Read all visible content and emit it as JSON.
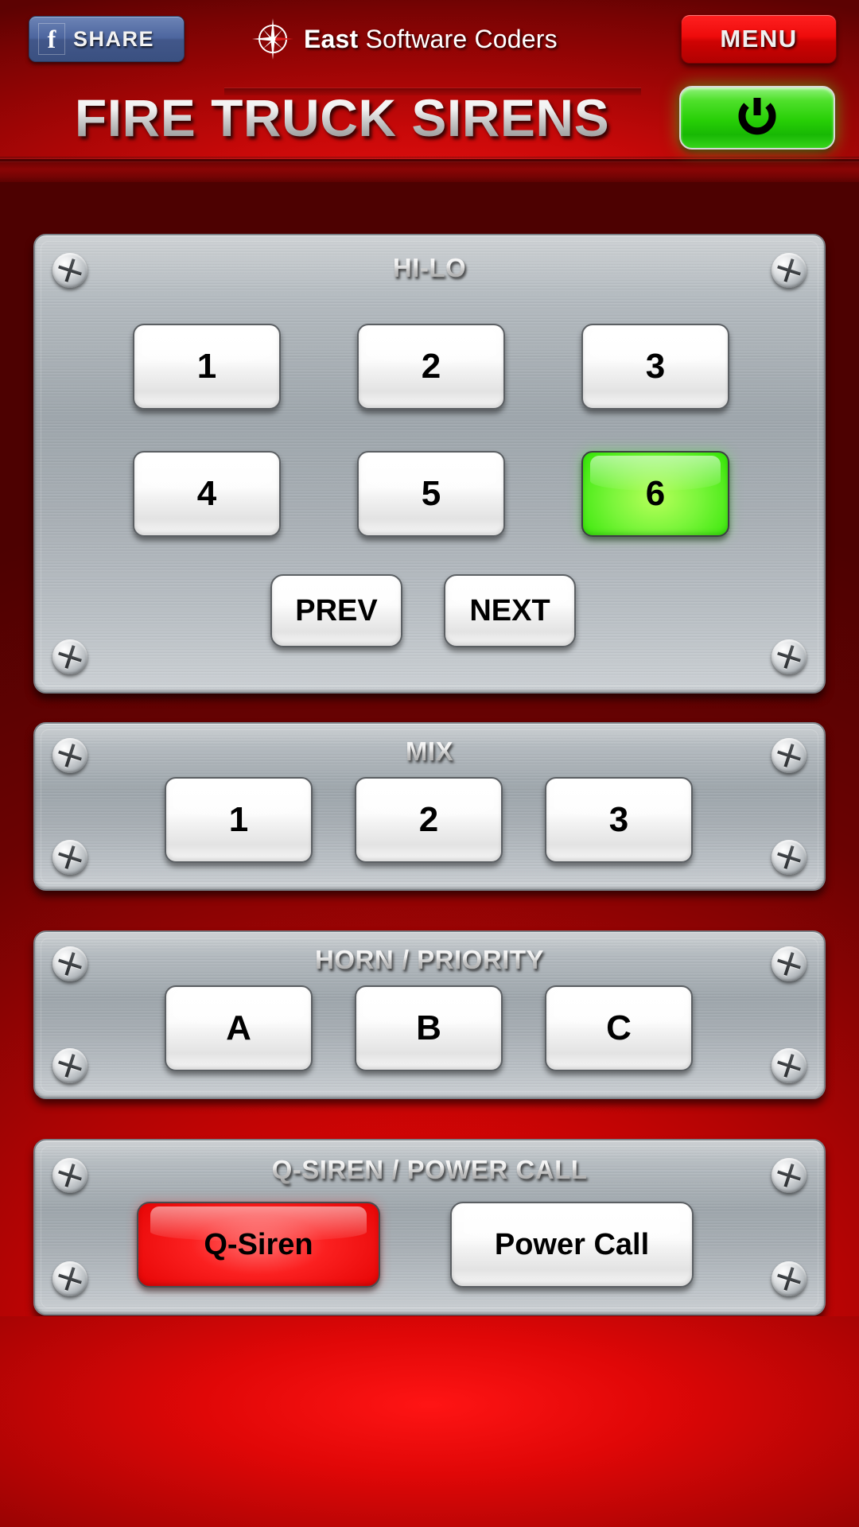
{
  "header": {
    "share_button": {
      "label": "SHARE",
      "icon": "facebook-icon",
      "glyph": "f",
      "color": "#4c659e"
    },
    "brand": {
      "name_bold": "East",
      "name_rest": " Software Coders",
      "icon": "compass-rose-icon"
    },
    "menu_button": {
      "label": "MENU",
      "color": "#ee0b0b"
    },
    "app_title": "FIRE TRUCK SIRENS",
    "power_button": {
      "icon": "power-icon",
      "state": "on",
      "color": "#27cf06"
    }
  },
  "panels": [
    {
      "id": "hi-lo",
      "title": "HI-LO",
      "buttons": [
        {
          "label": "1",
          "state": "off"
        },
        {
          "label": "2",
          "state": "off"
        },
        {
          "label": "3",
          "state": "off"
        },
        {
          "label": "4",
          "state": "off"
        },
        {
          "label": "5",
          "state": "off"
        },
        {
          "label": "6",
          "state": "active"
        }
      ],
      "nav": [
        {
          "label": "PREV"
        },
        {
          "label": "NEXT"
        }
      ]
    },
    {
      "id": "mix",
      "title": "MIX",
      "buttons": [
        {
          "label": "1",
          "state": "off"
        },
        {
          "label": "2",
          "state": "off"
        },
        {
          "label": "3",
          "state": "off"
        }
      ]
    },
    {
      "id": "horn-priority",
      "title": "HORN / PRIORITY",
      "buttons": [
        {
          "label": "A",
          "state": "off"
        },
        {
          "label": "B",
          "state": "off"
        },
        {
          "label": "C",
          "state": "off"
        }
      ]
    },
    {
      "id": "q-siren-power-call",
      "title": "Q-SIREN / POWER CALL",
      "buttons": [
        {
          "label": "Q-Siren",
          "state": "active"
        },
        {
          "label": "Power Call",
          "state": "off"
        }
      ]
    }
  ],
  "colors": {
    "background_red": "#a80404",
    "panel_metal": "#a7aeb4",
    "active_green": "#3ee80e",
    "active_red": "#e80707",
    "button_white": "#ffffff"
  }
}
